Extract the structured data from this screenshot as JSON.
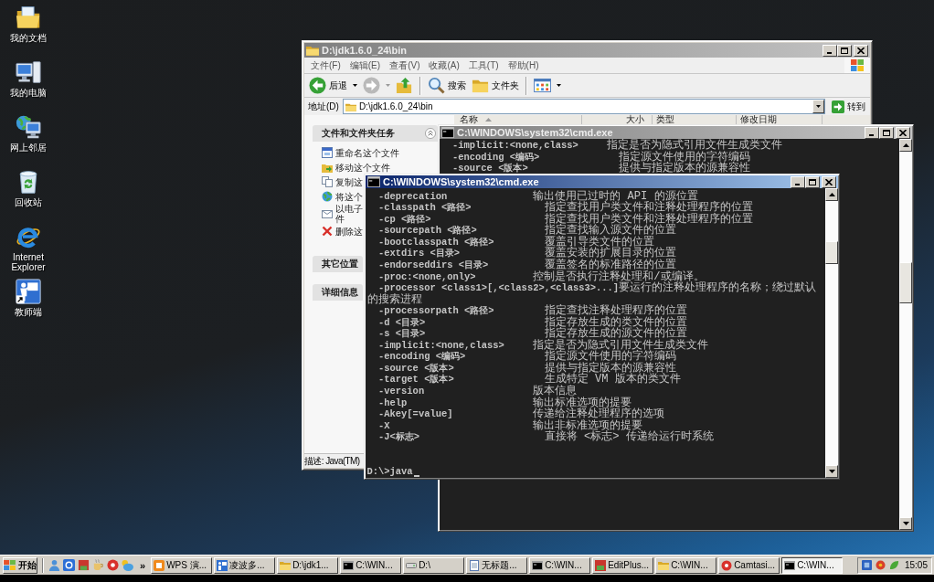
{
  "desktop_icons": [
    {
      "kind": "documents",
      "label": "我的文档"
    },
    {
      "kind": "computer",
      "label": "我的电脑"
    },
    {
      "kind": "network",
      "label": "网上邻居"
    },
    {
      "kind": "recycle",
      "label": "回收站"
    },
    {
      "kind": "browser",
      "label": "Internet Explorer"
    },
    {
      "kind": "teacher",
      "label": "教师端"
    }
  ],
  "explorer": {
    "title": "D:\\jdk1.6.0_24\\bin",
    "active": false,
    "menu": [
      "文件(F)",
      "编辑(E)",
      "查看(V)",
      "收藏(A)",
      "工具(T)",
      "帮助(H)"
    ],
    "toolbar": [
      {
        "items": [
          {
            "kind": "back",
            "label": "后退",
            "dropdown": true,
            "disabled": false
          },
          {
            "kind": "forward",
            "dropdown": true,
            "disabled": true
          },
          {
            "kind": "up",
            "dropdown": false,
            "disabled": false
          }
        ]
      },
      {
        "items": [
          {
            "kind": "search",
            "label": "搜索",
            "dropdown": false,
            "disabled": false
          },
          {
            "kind": "folders",
            "label": "文件夹",
            "dropdown": false,
            "disabled": false
          }
        ]
      },
      {
        "items": [
          {
            "kind": "views",
            "dropdown": true,
            "disabled": false
          }
        ]
      }
    ],
    "address": {
      "label": "地址(D)",
      "value": "D:\\jdk1.6.0_24\\bin",
      "go": "转到"
    },
    "task_sections": [
      {
        "title": "文件和文件夹任务",
        "items": [
          {
            "kind": "rename",
            "label": "重命名这个文件"
          },
          {
            "kind": "move",
            "label": "移动这个文件"
          },
          {
            "kind": "copy",
            "label": "复制这"
          },
          {
            "kind": "publish",
            "label": "将这个"
          },
          {
            "kind": "email",
            "label": "以电子件"
          },
          {
            "kind": "delete",
            "label": "删除这"
          }
        ]
      },
      {
        "title": "其它位置"
      },
      {
        "title": "详细信息"
      }
    ],
    "columns": [
      {
        "label": "名称",
        "sorted": true
      },
      {
        "label": "大小",
        "sorted": false
      },
      {
        "label": "类型",
        "sorted": false
      },
      {
        "label": "修改日期",
        "sorted": false
      }
    ],
    "status": "描述: Java(TM)"
  },
  "cmd_windows": [
    {
      "title": "C:\\WINDOWS\\system32\\cmd.exe",
      "active": false,
      "lines": [
        {
          "kind": "option",
          "option": "-implicit:<none,class>",
          "description": "指定是否为隐式引用文件生成类文件"
        },
        {
          "kind": "option",
          "option": "-encoding <编码>",
          "description": "指定源文件使用的字符编码"
        },
        {
          "kind": "option",
          "option": "-source <版本>",
          "description": "提供与指定版本的源兼容性"
        }
      ]
    },
    {
      "title": "C:\\WINDOWS\\system32\\cmd.exe",
      "active": true,
      "lines": [
        {
          "kind": "option",
          "option": "-deprecation",
          "description": "输出使用已过时的 API 的源位置"
        },
        {
          "kind": "option",
          "option": "-classpath <路径>",
          "description": "指定查找用户类文件和注释处理程序的位置"
        },
        {
          "kind": "option",
          "option": "-cp <路径>",
          "description": "指定查找用户类文件和注释处理程序的位置"
        },
        {
          "kind": "option",
          "option": "-sourcepath <路径>",
          "description": "指定查找输入源文件的位置"
        },
        {
          "kind": "option",
          "option": "-bootclasspath <路径>",
          "description": "覆盖引导类文件的位置"
        },
        {
          "kind": "option",
          "option": "-extdirs <目录>",
          "description": "覆盖安装的扩展目录的位置"
        },
        {
          "kind": "option",
          "option": "-endorseddirs <目录>",
          "description": "覆盖签名的标准路径的位置"
        },
        {
          "kind": "option",
          "option": "-proc:<none,only>",
          "description": "控制是否执行注释处理和/或编译。"
        },
        {
          "kind": "option",
          "option": "-processor <class1>[,<class2>,<class3>...]",
          "description": "要运行的注释处理程序的名称；绕过默认"
        },
        {
          "kind": "text",
          "text": "的搜索进程"
        },
        {
          "kind": "option",
          "option": "-processorpath <路径>",
          "description": "指定查找注释处理程序的位置"
        },
        {
          "kind": "option",
          "option": "-d <目录>",
          "description": "指定存放生成的类文件的位置"
        },
        {
          "kind": "option",
          "option": "-s <目录>",
          "description": "指定存放生成的源文件的位置"
        },
        {
          "kind": "option",
          "option": "-implicit:<none,class>",
          "description": "指定是否为隐式引用文件生成类文件"
        },
        {
          "kind": "option",
          "option": "-encoding <编码>",
          "description": "指定源文件使用的字符编码"
        },
        {
          "kind": "option",
          "option": "-source <版本>",
          "description": "提供与指定版本的源兼容性"
        },
        {
          "kind": "option",
          "option": "-target <版本>",
          "description": "生成特定 VM 版本的类文件"
        },
        {
          "kind": "option",
          "option": "-version",
          "description": "版本信息"
        },
        {
          "kind": "option",
          "option": "-help",
          "description": "输出标准选项的提要"
        },
        {
          "kind": "option",
          "option": "-Akey[=value]",
          "description": "传递给注释处理程序的选项"
        },
        {
          "kind": "option",
          "option": "-X",
          "description": "输出非标准选项的提要"
        },
        {
          "kind": "option",
          "option": "-J<标志>",
          "description": "直接将 <标志> 传递给运行时系统"
        }
      ],
      "prompt": "D:\\>java"
    }
  ],
  "taskbar": {
    "start": "开始",
    "quick_launch_more": "»",
    "tasks": [
      {
        "kind": "slides",
        "label": "WPS 演...",
        "selected": false
      },
      {
        "kind": "board",
        "label": "凌波多...",
        "selected": false
      },
      {
        "kind": "folder",
        "label": "D:\\jdk1...",
        "selected": false
      },
      {
        "kind": "console",
        "label": "C:\\WIN...",
        "selected": false
      },
      {
        "kind": "drive",
        "label": "D:\\",
        "selected": false
      },
      {
        "kind": "notepad",
        "label": "无标题...",
        "selected": false
      },
      {
        "kind": "console",
        "label": "C:\\WIN...",
        "selected": false
      },
      {
        "kind": "editor",
        "label": "EditPlus...",
        "selected": false
      },
      {
        "kind": "folder",
        "label": "C:\\WIN...",
        "selected": false
      },
      {
        "kind": "recorder",
        "label": "Camtasi...",
        "selected": false
      },
      {
        "kind": "console",
        "label": "C:\\WIN...",
        "selected": true
      }
    ],
    "clock": "15:05"
  }
}
